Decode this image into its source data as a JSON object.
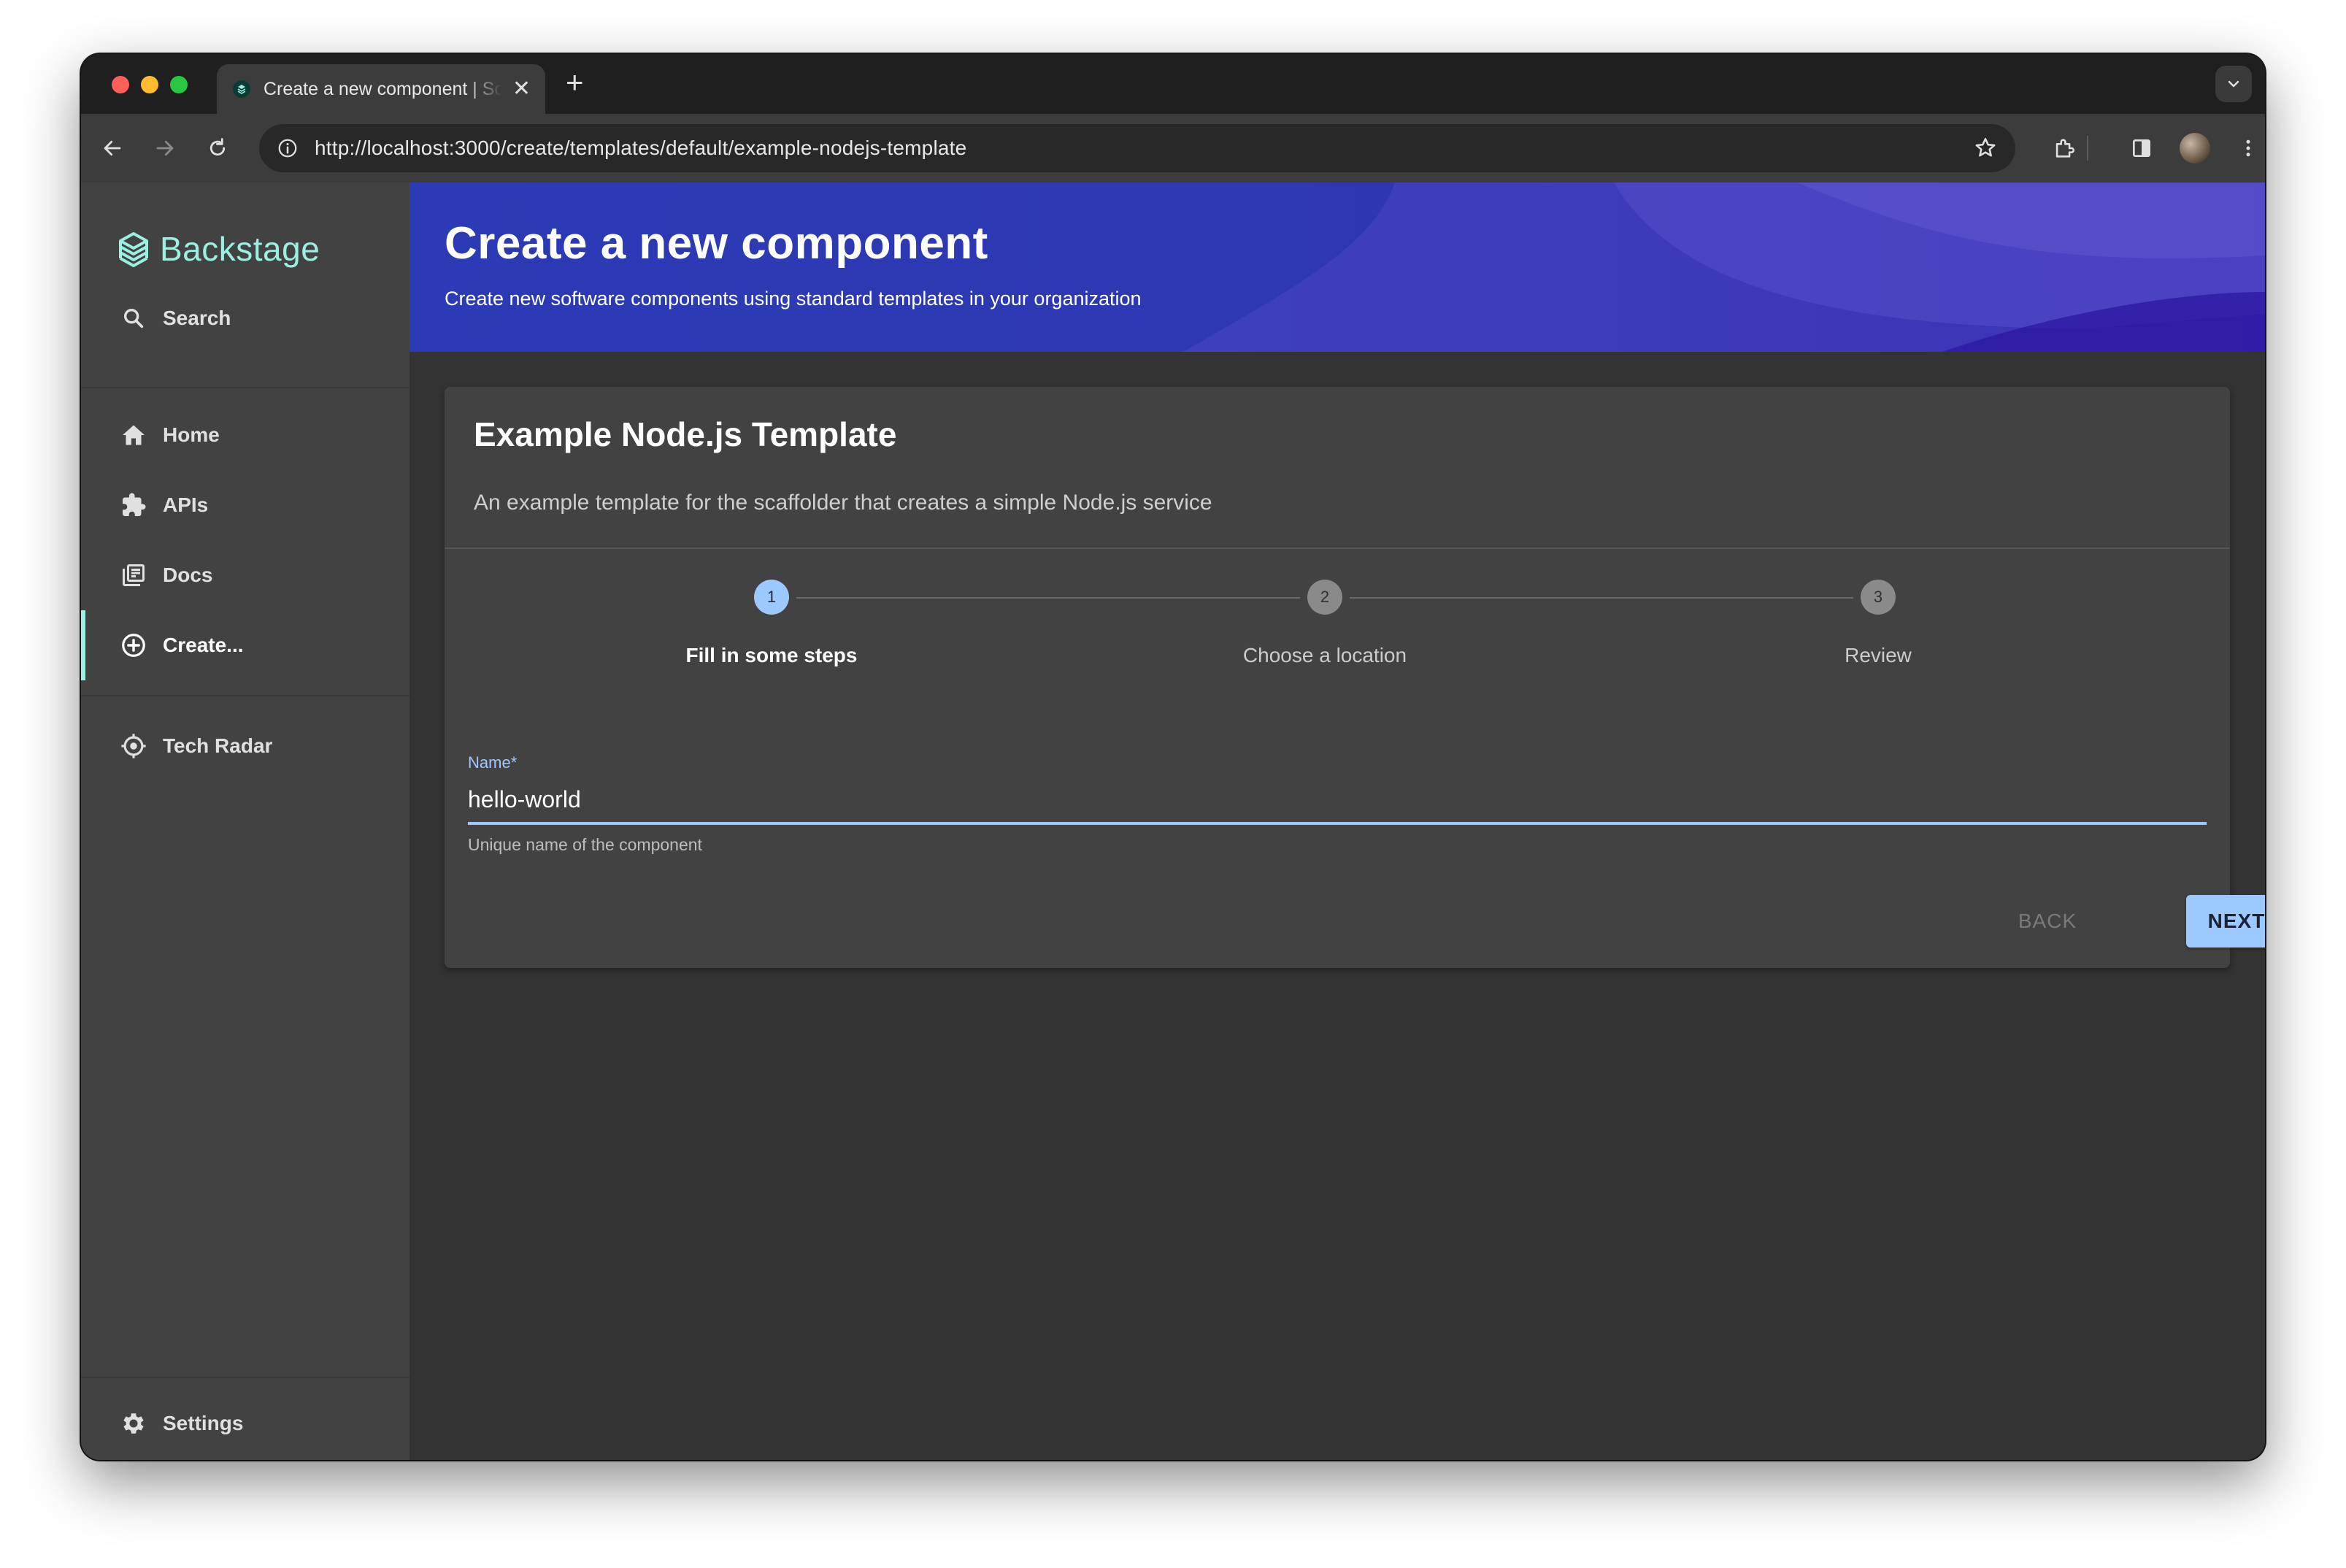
{
  "browser": {
    "tab_title": "Create a new component | Scaffolder | Backstage",
    "url": "http://localhost:3000/create/templates/default/example-nodejs-template"
  },
  "sidebar": {
    "logo_text": "Backstage",
    "search_label": "Search",
    "items": [
      {
        "label": "Home",
        "icon": "home-icon"
      },
      {
        "label": "APIs",
        "icon": "puzzle-icon"
      },
      {
        "label": "Docs",
        "icon": "library-books-icon"
      },
      {
        "label": "Create...",
        "icon": "add-circle-icon",
        "active": true
      }
    ],
    "tech_radar_label": "Tech Radar",
    "settings_label": "Settings"
  },
  "header": {
    "title": "Create a new component",
    "subtitle": "Create new software components using standard templates in your organization"
  },
  "card": {
    "title": "Example Node.js Template",
    "description": "An example template for the scaffolder that creates a simple Node.js service"
  },
  "stepper": {
    "active_step": 1,
    "steps": [
      {
        "number": "1",
        "label": "Fill in some steps"
      },
      {
        "number": "2",
        "label": "Choose a location"
      },
      {
        "number": "3",
        "label": "Review"
      }
    ]
  },
  "form": {
    "name_label": "Name",
    "name_required_mark": "*",
    "name_value": "hello-world",
    "name_help": "Unique name of the component"
  },
  "actions": {
    "back_label": "BACK",
    "next_label": "NEXT"
  },
  "colors": {
    "accent": "#9cc9ff",
    "logo": "#9bf0e1",
    "header_blue": "#2f37b0",
    "sidebar_bg": "#424242",
    "page_bg": "#333333"
  }
}
